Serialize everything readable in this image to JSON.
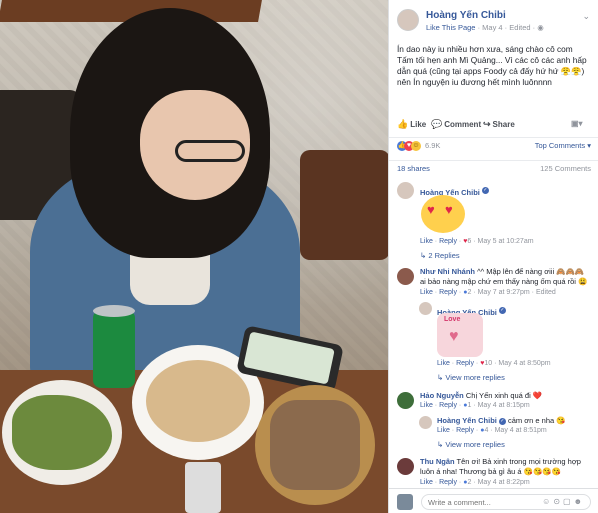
{
  "post": {
    "page_name": "Hoàng Yến Chibi",
    "like_page": "Like This Page",
    "date": "May 4",
    "edited": "Edited",
    "caption": "Ín dao này iu nhiều hơn xưa, sáng chào cô com Tấm tối hẹn anh Mì Quảng... Vì các cô các anh hấp dẫn quá (cũng tại apps Foody cả đấy hứ hứ 😤😤) nên Ín nguyện iu đương hết mình luônnnn"
  },
  "actions": {
    "like": "Like",
    "comment": "Comment",
    "share": "Share"
  },
  "stats": {
    "reactions": "6.9K",
    "top_comments": "Top Comments",
    "shares": "18 shares",
    "comments": "125 Comments"
  },
  "comments": [
    {
      "name": "Hoàng Yến Chibi",
      "meta_like": "Like",
      "meta_reply": "Reply",
      "meta_count": "6",
      "time": "May 5 at 10:27am",
      "replies": "2 Replies"
    },
    {
      "name": "Như Nhi Nhánh",
      "text": "^^ Mập lên để nàng ơiii 🙈🙈🙈 ai bảo nàng mập chứ em thấy nàng ốm quá rồi 😩",
      "meta_like": "Like",
      "meta_reply": "Reply",
      "meta_count": "2",
      "time": "May 7 at 9:27pm",
      "edited": "Edited"
    },
    {
      "name": "Hoàng Yến Chibi",
      "sticker_text": "Love",
      "meta_like": "Like",
      "meta_reply": "Reply",
      "meta_count": "10",
      "time": "May 4 at 8:50pm",
      "more": "View more replies"
    },
    {
      "name": "Hảo Nguyễn",
      "text": "Chị Yến xinh quá đi ❤️",
      "meta_like": "Like",
      "meta_reply": "Reply",
      "meta_count": "1",
      "time": "May 4 at 8:15pm"
    },
    {
      "name": "Hoàng Yến Chibi",
      "text": "cảm ơn e nha 😘",
      "meta_like": "Like",
      "meta_reply": "Reply",
      "meta_count": "4",
      "time": "May 4 at 8:51pm",
      "more": "View more replies"
    },
    {
      "name": "Thu Ngân",
      "text": "Tên ơi! Bả xinh trong mọi trường hợp luôn á nha! Thương bả gì âu á 😘😘😘😘",
      "meta_like": "Like",
      "meta_reply": "Reply",
      "meta_count": "2",
      "time": "May 4 at 8:22pm"
    }
  ],
  "input": {
    "placeholder": "Write a comment..."
  }
}
